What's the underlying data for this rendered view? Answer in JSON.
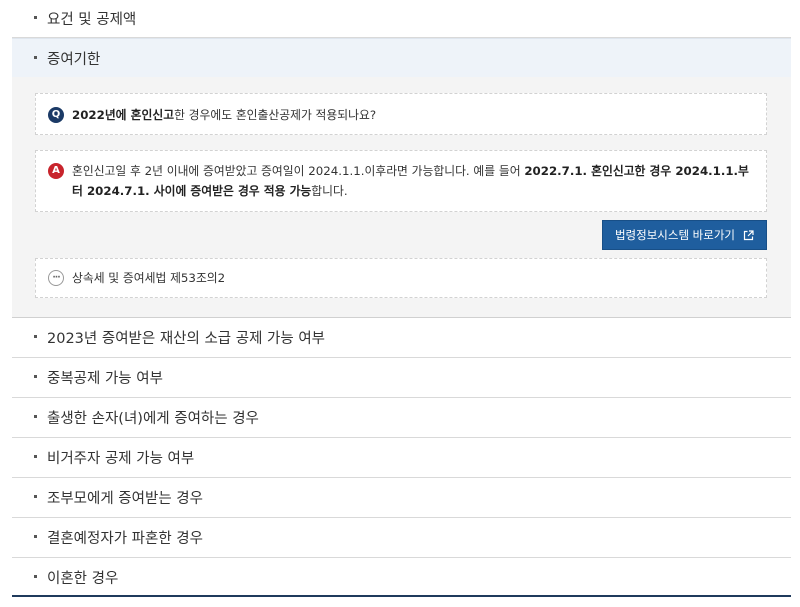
{
  "accordion": {
    "items": [
      {
        "label": "요건 및 공제액"
      },
      {
        "label": "증여기한"
      },
      {
        "label": "2023년 증여받은 재산의 소급 공제 가능 여부"
      },
      {
        "label": "중복공제 가능 여부"
      },
      {
        "label": "출생한 손자(녀)에게 증여하는 경우"
      },
      {
        "label": "비거주자 공제 가능 여부"
      },
      {
        "label": "조부모에게 증여받는 경우"
      },
      {
        "label": "결혼예정자가 파혼한 경우"
      },
      {
        "label": "이혼한 경우"
      }
    ]
  },
  "faq": {
    "q_badge": "Q",
    "q_bold": "2022년에 혼인신고",
    "q_text": "한 경우에도 혼인출산공제가 적용되나요?",
    "a_badge": "A",
    "a_text1": "혼인신고일 후 2년 이내에 증여받았고 증여일이 2024.1.1.이후라면 가능합니다. 예를 들어 ",
    "a_bold": "2022.7.1. 혼인신고한 경우 2024.1.1.부터 2024.7.1. 사이에 증여받은 경우 적용 가능",
    "a_text2": "합니다.",
    "law_button": "법령정보시스템 바로가기",
    "more_badge": "···",
    "law_ref": "상속세 및 증여세법 제53조의2"
  },
  "colors": {
    "q_badge": "#1b3a66",
    "a_badge": "#c8242c",
    "button": "#1f5e9e",
    "open_header": "#eef3f9",
    "panel": "#f4f4f4"
  }
}
